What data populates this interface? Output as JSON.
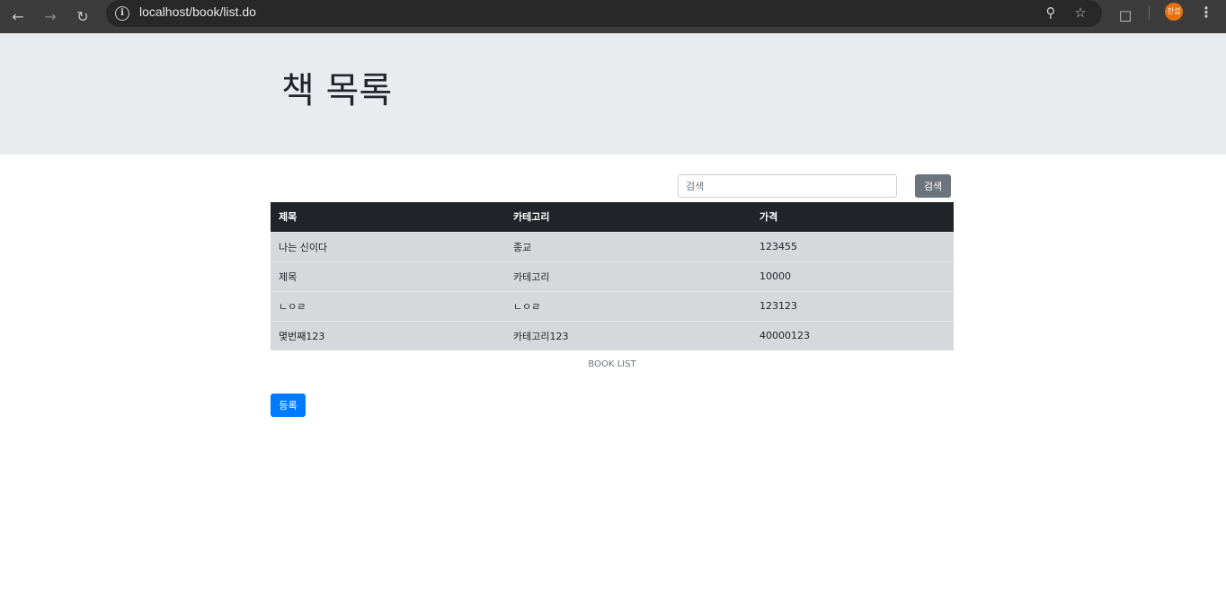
{
  "browser": {
    "url": "localhost/book/list.do",
    "avatar_text": "찬섭",
    "icons": [
      "back-arrow-icon",
      "forward-arrow-icon",
      "reload-icon",
      "info-icon",
      "zoom-icon",
      "star-icon",
      "extensions-icon",
      "menu-icon"
    ]
  },
  "header": {
    "title": "책 목록"
  },
  "search": {
    "placeholder": "검색",
    "button_label": "검색"
  },
  "table": {
    "columns": [
      "제목",
      "카테고리",
      "가격"
    ],
    "rows": [
      [
        "나는 신이다",
        "종교",
        "123455"
      ],
      [
        "제목",
        "카테고리",
        "10000"
      ],
      [
        "ㄴㅇㄹ",
        "ㄴㅇㄹ",
        "123123"
      ],
      [
        "몇번째123",
        "카테고리123",
        "40000123"
      ]
    ],
    "caption": "BOOK LIST"
  },
  "actions": {
    "register_label": "등록"
  },
  "colors": {
    "header_bg": "#e9ecef",
    "table_head_bg": "#212529",
    "row_bg": "#d6d8db",
    "primary": "#007bff",
    "secondary": "#6c757d"
  }
}
